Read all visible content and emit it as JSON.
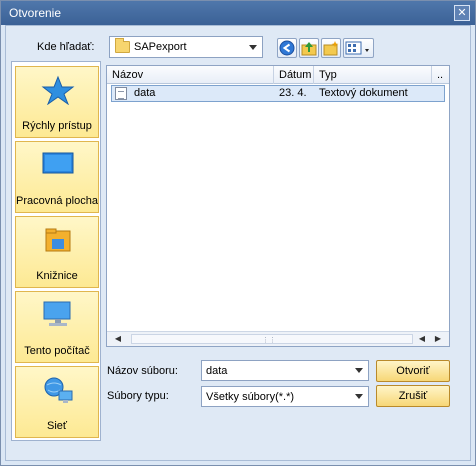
{
  "window": {
    "title": "Otvorenie"
  },
  "look_in": {
    "label": "Kde hľadať:",
    "value": "SAPexport"
  },
  "toolbar": {
    "icons": [
      "back-icon",
      "up-folder-icon",
      "new-folder-icon",
      "view-menu-icon"
    ]
  },
  "places": [
    {
      "label": "Rýchly prístup",
      "icon": "star-icon"
    },
    {
      "label": "Pracovná plocha",
      "icon": "desktop-icon"
    },
    {
      "label": "Knižnice",
      "icon": "library-icon"
    },
    {
      "label": "Tento počítač",
      "icon": "computer-icon"
    },
    {
      "label": "Sieť",
      "icon": "network-icon"
    }
  ],
  "file_list": {
    "columns": [
      "Názov",
      "Dátum",
      "Typ",
      ".."
    ],
    "rows": [
      {
        "name": "data",
        "date": "23. 4.",
        "type": "Textový dokument"
      }
    ]
  },
  "file_name": {
    "label": "Názov súboru:",
    "value": "data"
  },
  "file_type": {
    "label": "Súbory typu:",
    "value": "Všetky súbory(*.*)"
  },
  "buttons": {
    "open": "Otvoriť",
    "cancel": "Zrušiť"
  },
  "colors": {
    "title_bar": "#3f6599",
    "button_face": "#f9df86",
    "selection": "#dce9f9"
  }
}
